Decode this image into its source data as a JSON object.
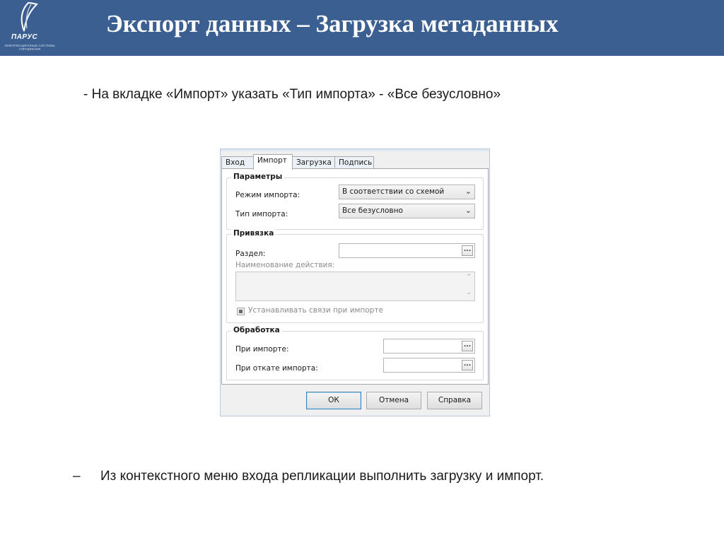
{
  "slide": {
    "title": "Экспорт данных – Загрузка метаданных",
    "instruction_1": "- На вкладке «Импорт» указать «Тип импорта» - «Все безусловно»",
    "bullet_marker": "–",
    "instruction_2": "Из контекстного меню входа репликации выполнить загрузку и импорт.",
    "header_color": "#3a5f90"
  },
  "logo": {
    "wordmark": "ПАРУС",
    "tagline": "ИНФОРМАЦИОННЫЕ СИСТЕМЫ УПРАВЛЕНИЯ",
    "icon": "sail-logo-icon"
  },
  "dialog": {
    "tabs": [
      {
        "label": "Вход",
        "active": false
      },
      {
        "label": "Импорт",
        "active": true
      },
      {
        "label": "Загрузка",
        "active": false
      },
      {
        "label": "Подпись",
        "active": false
      }
    ],
    "params_group": {
      "label": "Параметры",
      "import_mode_label": "Режим импорта:",
      "import_mode_value": "В соответствии со схемой",
      "import_type_label": "Тип импорта:",
      "import_type_value": "Все безусловно"
    },
    "binding_group": {
      "label": "Привязка",
      "section_label": "Раздел:",
      "section_value": "",
      "action_name_label": "Наименование действия:",
      "action_name_value": "",
      "set_links_label": "Устанавливать связи при импорте",
      "set_links_checked": "indeterminate"
    },
    "processing_group": {
      "label": "Обработка",
      "on_import_label": "При импорте:",
      "on_import_value": "",
      "on_rollback_label": "При откате импорта:",
      "on_rollback_value": ""
    },
    "buttons": {
      "ok": "ОК",
      "cancel": "Отмена",
      "help": "Справка"
    },
    "lookup_glyph": "...",
    "combo_arrow_glyph": "⌄",
    "memo_scroll_up_glyph": "⌃",
    "memo_scroll_down_glyph": "⌄"
  }
}
